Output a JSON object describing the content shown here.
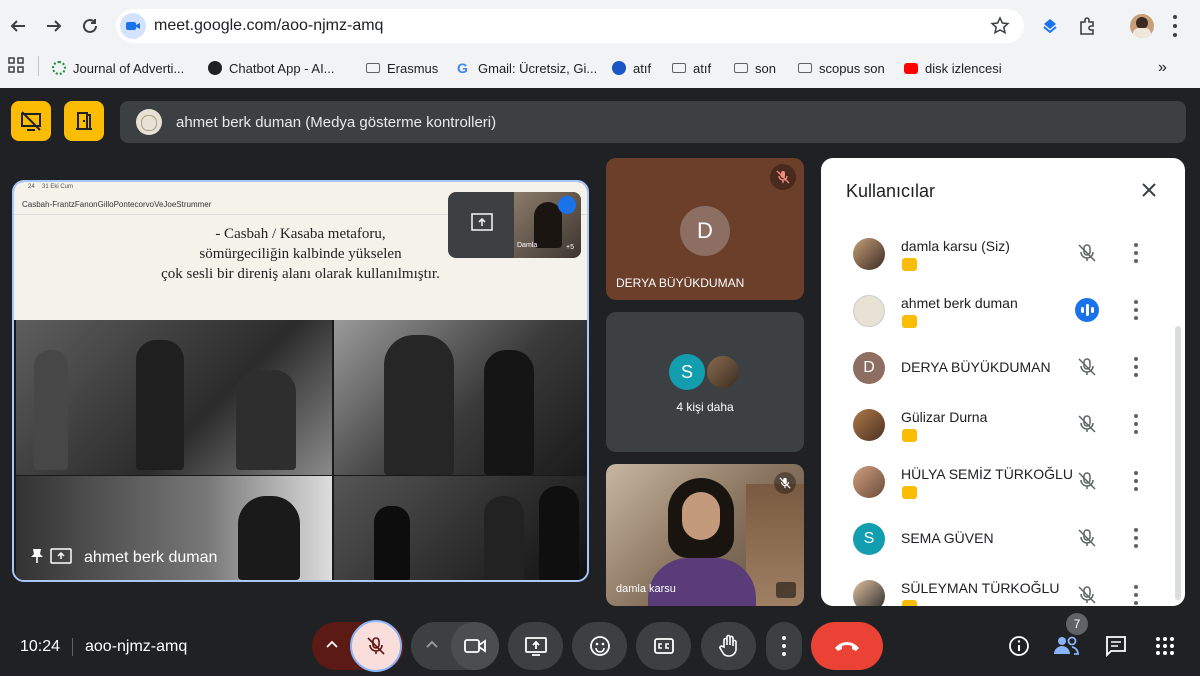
{
  "browser": {
    "url": "meet.google.com/aoo-njmz-amq",
    "bookmarks": [
      {
        "label": "Journal of Adverti..."
      },
      {
        "label": "Chatbot App - AI..."
      },
      {
        "label": "Erasmus"
      },
      {
        "label": "Gmail: Ücretsiz, Gi..."
      },
      {
        "label": "atıf"
      },
      {
        "label": "atıf"
      },
      {
        "label": "son"
      },
      {
        "label": "scopus son"
      },
      {
        "label": "disk izlencesi"
      }
    ],
    "overflow": "»"
  },
  "meet": {
    "presenter_bar": "ahmet berk duman (Medya gösterme kontrolleri)",
    "main_tile": {
      "name": "ahmet berk duman",
      "slide_time": "24",
      "slide_date": "31 Eki Cum",
      "slide_filename": "Casbah-FrantzFanonGilloPontecorvoVeJoeStrummer",
      "slide_text": [
        "- Casbah / Kasaba metaforu,",
        "sömürgeciliğin kalbinde yükselen",
        "çok sesli bir direniş alanı olarak kullanılmıştır."
      ],
      "pip_label": "Damla",
      "pip_count": "+5"
    },
    "tiles": [
      {
        "name": "DERYA BÜYÜKDUMAN",
        "initial": "D"
      },
      {
        "initial": "S",
        "more_label": "4 kişi daha"
      },
      {
        "name": "damla karsu"
      }
    ]
  },
  "panel": {
    "title": "Kullanıcılar",
    "participants": [
      {
        "name": "damla karsu (Siz)",
        "avatar": "photo",
        "presenting": true,
        "muted": true
      },
      {
        "name": "ahmet berk duman",
        "avatar": "photo",
        "presenting": true,
        "muted": false,
        "speaking": true
      },
      {
        "name": "DERYA BÜYÜKDUMAN",
        "avatar": "initial",
        "initial": "D",
        "avatar_color": "#8d6e63",
        "presenting": false,
        "muted": true
      },
      {
        "name": "Gülizar Durna",
        "avatar": "photo",
        "presenting": true,
        "muted": true
      },
      {
        "name": "HÜLYA SEMİZ TÜRKOĞLU",
        "avatar": "photo",
        "presenting": true,
        "muted": true
      },
      {
        "name": "SEMA GÜVEN",
        "avatar": "initial",
        "initial": "S",
        "avatar_color": "#129eaf",
        "presenting": false,
        "muted": true
      },
      {
        "name": "SÜLEYMAN TÜRKOĞLU",
        "avatar": "photo",
        "presenting": true,
        "muted": true
      }
    ]
  },
  "bottom": {
    "time": "10:24",
    "meeting_code": "aoo-njmz-amq",
    "participant_count": "7"
  },
  "colors": {
    "accent_yellow": "#fbbc04",
    "end_call": "#ea4335",
    "mic_off_bg": "#f9dedc",
    "mic_off_border": "#8ab4f8",
    "speaking": "#1a73e8"
  }
}
